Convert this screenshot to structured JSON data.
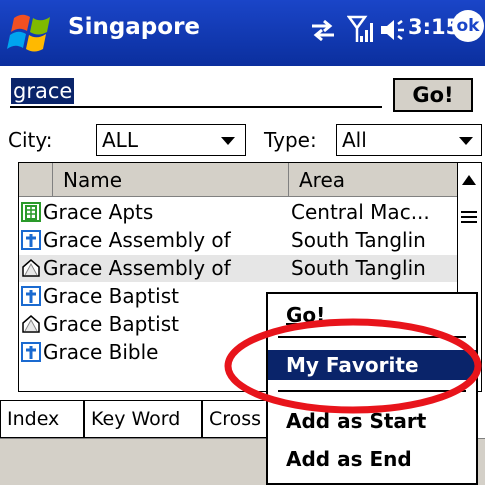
{
  "title_bar": {
    "app_title": "Singapore",
    "clock": "3:15",
    "ok_label": "ok",
    "icons": [
      "windows-start-icon",
      "connectivity-icon",
      "signal-icon",
      "volume-icon"
    ]
  },
  "search": {
    "value": "grace",
    "go_label": "Go!"
  },
  "filters": {
    "city_label": "City:",
    "city_value": "ALL",
    "type_label": "Type:",
    "type_value": "All"
  },
  "list": {
    "columns": [
      "Name",
      "Area"
    ],
    "rows": [
      {
        "icon": "building-icon",
        "name": "Grace Apts",
        "area": "Central Mac..."
      },
      {
        "icon": "church-cross-icon",
        "name": "Grace Assembly of",
        "area": "South Tanglin"
      },
      {
        "icon": "house-icon",
        "name": "Grace Assembly of",
        "area": "South Tanglin"
      },
      {
        "icon": "church-cross-icon",
        "name": "Grace Baptist",
        "area": ""
      },
      {
        "icon": "house-icon",
        "name": "Grace Baptist",
        "area": ""
      },
      {
        "icon": "church-cross-icon",
        "name": "Grace Bible",
        "area": ""
      }
    ]
  },
  "tabs": [
    "Index",
    "Key Word",
    "Cross"
  ],
  "context_menu": {
    "items": [
      "Go!",
      "My Favorite",
      "Add as Start",
      "Add as End"
    ],
    "highlighted": "My Favorite"
  },
  "colors": {
    "title_bar": "#1a45c8",
    "selection": "#0a246a",
    "annotation": "#e8141b"
  }
}
